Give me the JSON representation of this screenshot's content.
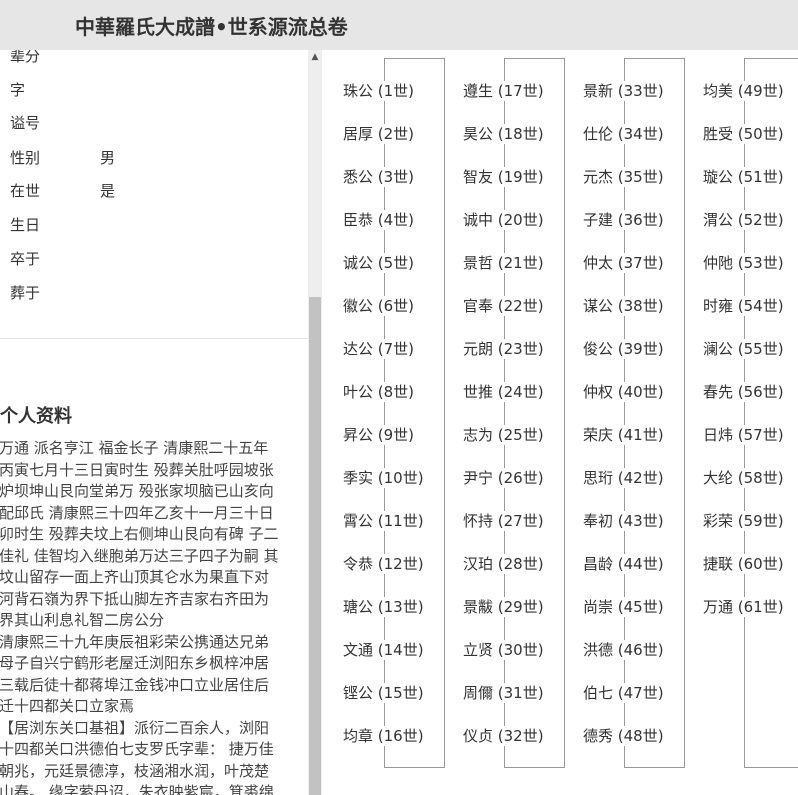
{
  "header": {
    "title": "中華羅氏大成譜•世系源流总卷"
  },
  "person_fields": [
    {
      "label": "辈分",
      "value": ""
    },
    {
      "label": "字",
      "value": ""
    },
    {
      "label": "谥号",
      "value": ""
    },
    {
      "label": "性别",
      "value": "男"
    },
    {
      "label": "在世",
      "value": "是"
    },
    {
      "label": "生日",
      "value": ""
    },
    {
      "label": "卒于",
      "value": ""
    },
    {
      "label": "葬于",
      "value": ""
    }
  ],
  "profile": {
    "title": "个人资料",
    "text": "万通 派名亨江 福金长子 清康熙二十五年\n丙寅七月十三日寅时生 殁葬关肚呼园坡张\n炉坝坤山艮向堂弟万 殁张家坝脑已山亥向\n配邱氏 清康熙三十四年乙亥十一月三十日\n卯时生 殁葬夫坟上右侧坤山艮向有碑 子二\n佳礼 佳智均入继胞弟万达三子四子为嗣 其\n坟山留存一面上齐山顶其仑水为果直下对\n河背石嶺为界下抵山脚左齐吉家右齐田为\n界其山利息礼智二房公分\n 清康熙三十九年庚辰祖彩荣公携通达兄弟\n母子自兴宁鹤形老屋迁浏阳东乡枫梓冲居\n三载后徒十都蒋埠江金钱冲口立业居住后\n迁十四都关口立家焉\n【居浏东关口基祖】派衍二百余人，浏阳\n十四都关口洪德伯七支罗氏字辈： 捷万佳\n朝兆，元廷景德淳，枝涵湘水润，叶茂楚\n山春。 缘字萦丹诏，朱衣映紫宸，箕裘绵\n沛泽，浩轴益绿纶。"
  },
  "generations": [
    [
      "珠公 (1世)",
      "居厚 (2世)",
      "悉公 (3世)",
      "臣恭 (4世)",
      "诚公 (5世)",
      "徽公 (6世)",
      "达公 (7世)",
      "叶公 (8世)",
      "昇公 (9世)",
      "季实 (10世)",
      "霄公 (11世)",
      "令恭 (12世)",
      "瑭公 (13世)",
      "文通 (14世)",
      "铿公 (15世)",
      "均章 (16世)"
    ],
    [
      "遵生 (17世)",
      "昊公 (18世)",
      "智友 (19世)",
      "诚中 (20世)",
      "景哲 (21世)",
      "官奉 (22世)",
      "元朗 (23世)",
      "世推 (24世)",
      "志为 (25世)",
      "尹宁 (26世)",
      "怀持 (27世)",
      "汉珀 (28世)",
      "景黻 (29世)",
      "立贤 (30世)",
      "周儞 (31世)",
      "仪贞 (32世)"
    ],
    [
      "景新 (33世)",
      "仕伦 (34世)",
      "元杰 (35世)",
      "子建 (36世)",
      "仲太 (37世)",
      "谋公 (38世)",
      "俊公 (39世)",
      "仲权 (40世)",
      "荣庆 (41世)",
      "思珩 (42世)",
      "奉初 (43世)",
      "昌龄 (44世)",
      "尚崇 (45世)",
      "洪德 (46世)",
      "伯七 (47世)",
      "德秀 (48世)"
    ],
    [
      "均美 (49世)",
      "胜受 (50世)",
      "璇公 (51世)",
      "渭公 (52世)",
      "仲阤 (53世)",
      "时雍 (54世)",
      "澜公 (55世)",
      "春先 (56世)",
      "日炜 (57世)",
      "大纶 (58世)",
      "彩荣 (59世)",
      "捷联 (60世)",
      "万通 (61世)"
    ]
  ],
  "icons": {
    "scroll_up": "triangle-up-icon"
  }
}
